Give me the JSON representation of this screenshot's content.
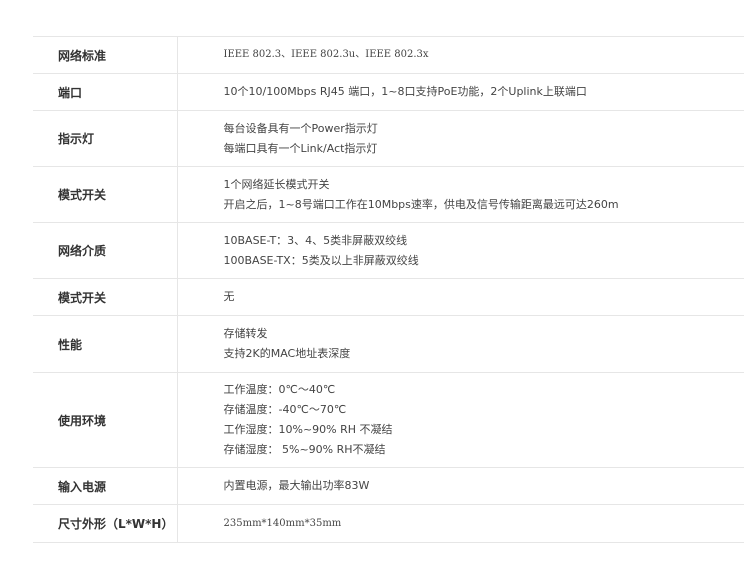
{
  "specs": [
    {
      "name": "网络标准",
      "lines": [
        "IEEE 802.3、IEEE 802.3u、IEEE 802.3x"
      ]
    },
    {
      "name": "端口",
      "lines": [
        "10个10/100Mbps RJ45 端口，1~8口支持PoE功能，2个Uplink上联端口"
      ]
    },
    {
      "name": "指示灯",
      "lines": [
        "每台设备具有一个Power指示灯",
        "每端口具有一个Link/Act指示灯"
      ]
    },
    {
      "name": "模式开关",
      "lines": [
        "1个网络延长模式开关",
        "开启之后，1~8号端口工作在10Mbps速率，供电及信号传输距离最远可达260m"
      ]
    },
    {
      "name": "网络介质",
      "lines": [
        "10BASE-T：3、4、5类非屏蔽双绞线",
        "100BASE-TX：5类及以上非屏蔽双绞线"
      ]
    },
    {
      "name": "模式开关",
      "lines": [
        "无"
      ]
    },
    {
      "name": "性能",
      "lines": [
        "存储转发",
        "支持2K的MAC地址表深度"
      ]
    },
    {
      "name": "使用环境",
      "lines": [
        "工作温度：0℃～40℃",
        "存储温度：-40℃～70℃",
        "工作湿度：10%~90% RH 不凝结",
        "存储湿度： 5%~90% RH不凝结"
      ]
    },
    {
      "name": "输入电源",
      "lines": [
        "内置电源，最大输出功率83W"
      ]
    },
    {
      "name": "尺寸外形（L*W*H）",
      "lines": [
        "235mm*140mm*35mm"
      ]
    }
  ]
}
